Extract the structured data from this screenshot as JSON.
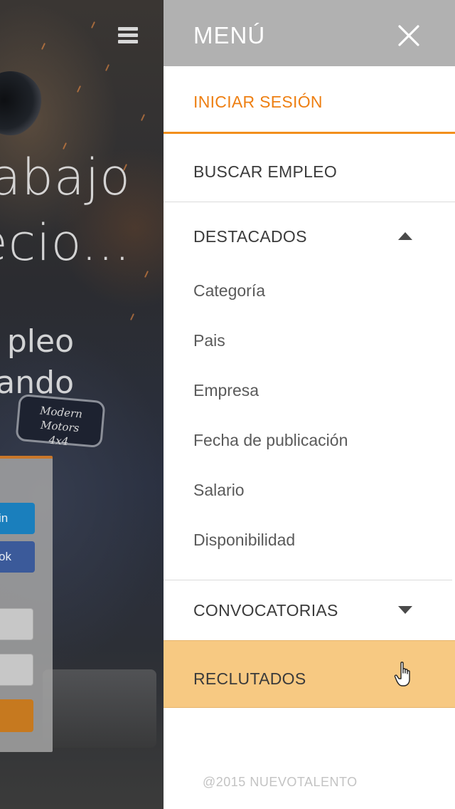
{
  "background": {
    "headline_lines": [
      "abajo",
      "ecio..."
    ],
    "subheadline_lines": [
      "pleo",
      "ando"
    ],
    "shirt_patch_lines": [
      "Modern Motors",
      "4x4"
    ],
    "login_card": {
      "linkedin_label": "in",
      "facebook_label": "ok"
    }
  },
  "menu": {
    "title": "MENÚ",
    "login": "INICIAR SESIÓN",
    "buscar": "BUSCAR EMPLEO",
    "destacados": {
      "label": "DESTACADOS",
      "expanded": true,
      "items": [
        "Categoría",
        "Pais",
        "Empresa",
        "Fecha de publicación",
        "Salario",
        "Disponibilidad"
      ]
    },
    "convocatorias": {
      "label": "CONVOCATORIAS",
      "expanded": false
    },
    "reclutados": {
      "label": "RECLUTADOS",
      "highlighted": true
    }
  },
  "footer": {
    "copyright": "@2015 NUEVOTALENTO"
  },
  "colors": {
    "accent": "#f28f1c",
    "login_text": "#ee7f12",
    "header_bg": "#b1b1b1",
    "highlight_bg": "#f7c982"
  }
}
